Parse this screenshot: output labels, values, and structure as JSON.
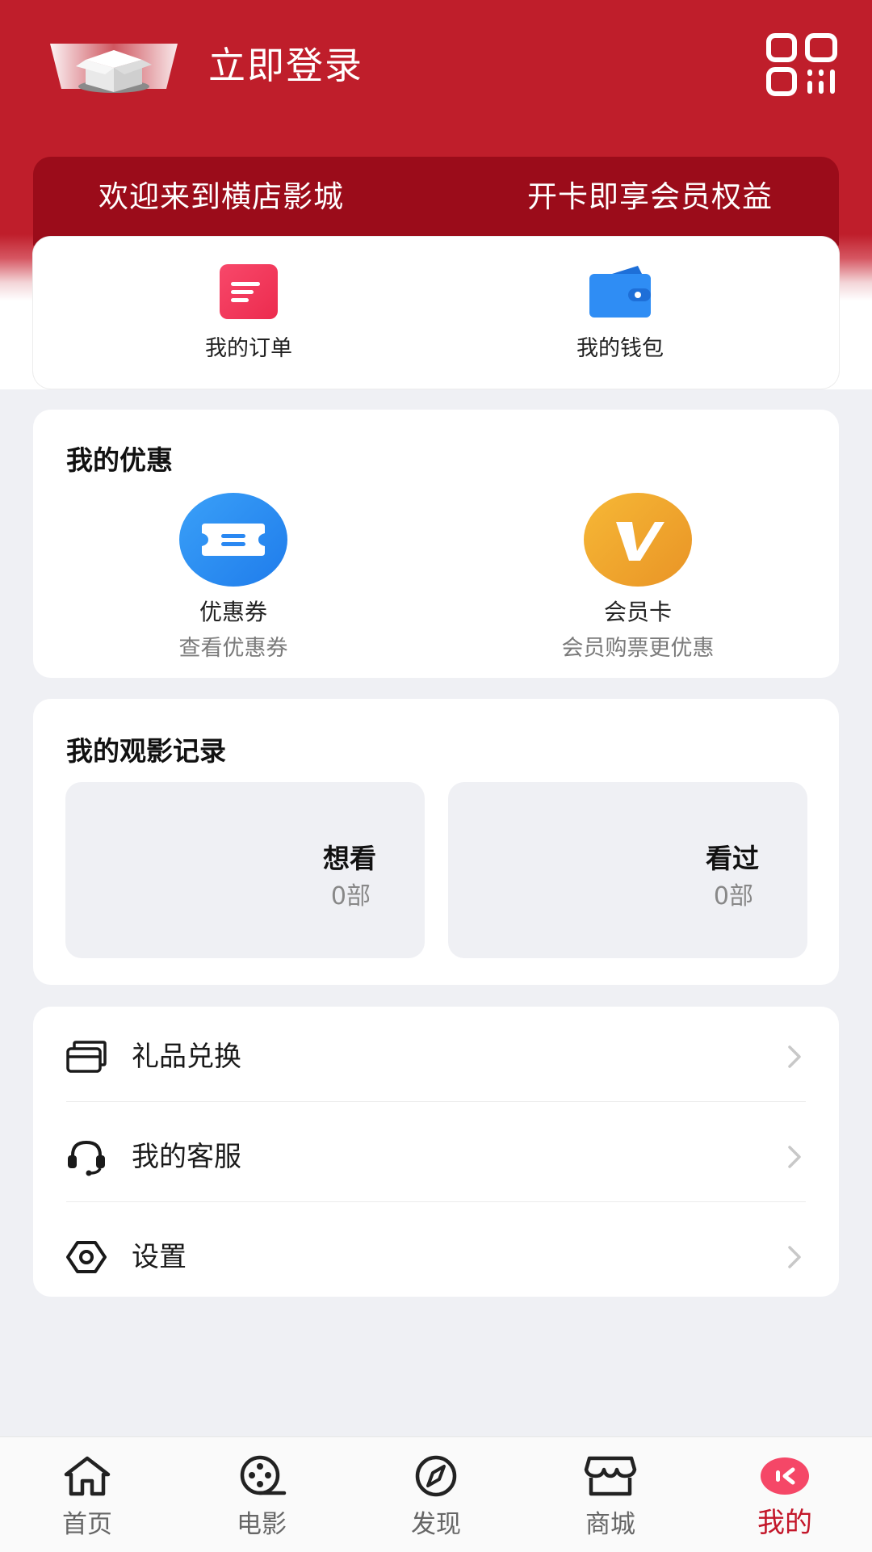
{
  "header": {
    "login_label": "立即登录",
    "avatar_icon": "gift-box-icon",
    "scan_icon": "qr-scan-icon"
  },
  "welcome_bar": {
    "left_text": "欢迎来到横店影城",
    "right_text": "开卡即享会员权益"
  },
  "quick_actions": {
    "orders": {
      "label": "我的订单",
      "icon": "order-list-icon"
    },
    "wallet": {
      "label": "我的钱包",
      "icon": "wallet-icon"
    }
  },
  "promotions": {
    "title": "我的优惠",
    "coupon": {
      "name": "优惠券",
      "sub": "查看优惠券",
      "icon": "ticket-icon"
    },
    "member": {
      "name": "会员卡",
      "sub": "会员购票更优惠",
      "icon": "v-badge-icon"
    }
  },
  "records": {
    "title": "我的观影记录",
    "want": {
      "title": "想看",
      "count": "0部"
    },
    "seen": {
      "title": "看过",
      "count": "0部"
    }
  },
  "menu": {
    "gift": {
      "label": "礼品兑换",
      "icon": "card-icon"
    },
    "service": {
      "label": "我的客服",
      "icon": "headset-icon"
    },
    "settings": {
      "label": "设置",
      "icon": "hexagon-gear-icon"
    }
  },
  "tabbar": {
    "home": "首页",
    "movie": "电影",
    "discover": "发现",
    "mall": "商城",
    "mine": "我的",
    "active": "mine"
  },
  "colors": {
    "brand_red": "#BF1E2B",
    "welcome_red": "#9B0C1A",
    "active_tab": "#C3172A",
    "page_bg": "#EFF0F4"
  }
}
